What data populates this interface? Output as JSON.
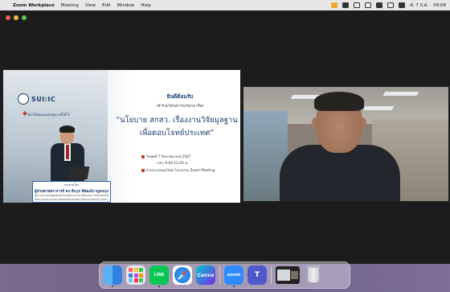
{
  "menubar": {
    "app_name": "Zoom Workplace",
    "items": [
      "Meeting",
      "View",
      "Edit",
      "Window",
      "Help"
    ],
    "clock": "ศ. 7 ส.ค.",
    "time": "09:04"
  },
  "slide": {
    "logo": "SUI:IC",
    "series": "นักวิจัยพบแหล่งทุน ครั้งที่ 2",
    "welcome": "ยินดีต้อนรับ",
    "invite": "เข้าร่วมโครงการบรรยาย เรื่อง",
    "title_line1": "“นโยบาย สกสว. เรื่องงานวิจัยมูลฐาน",
    "title_line2": "เพื่อตอบโจทย์ประเทศ”",
    "date": "วันพุธที่ 7 สิงหาคม พ.ศ.2567",
    "time": "เวลา 9.00-12.00 น.",
    "platform": "ผ่านระบบออนไลน์ โปรแกรม Zoom Meeting",
    "speaker_role": "บรรยายโดย",
    "speaker_name": "ผู้ช่วยศาสตราจารย์ ดร.ชินวุธ พิพัฒน์กาญจนกุล",
    "speaker_pos1": "ผู้อำนวยการฝ่ายยุทธศาสตร์และพัฒนาระบบ สำนักงานการวิจัยแห่งชาติ",
    "speaker_pos2": "สำนักงานคณะกรรมการส่งเสริมวิทยาศาสตร์ วิจัยและนวัตกรรม (สกสว.)"
  },
  "dock": {
    "items": [
      "Finder",
      "Launchpad",
      "LINE",
      "Safari",
      "Canva",
      "zoom",
      "Teams",
      "Zoom Meeting",
      "Trash"
    ],
    "line_label": "LINE",
    "canva_label": "Canva",
    "zoom_label": "zoom"
  }
}
